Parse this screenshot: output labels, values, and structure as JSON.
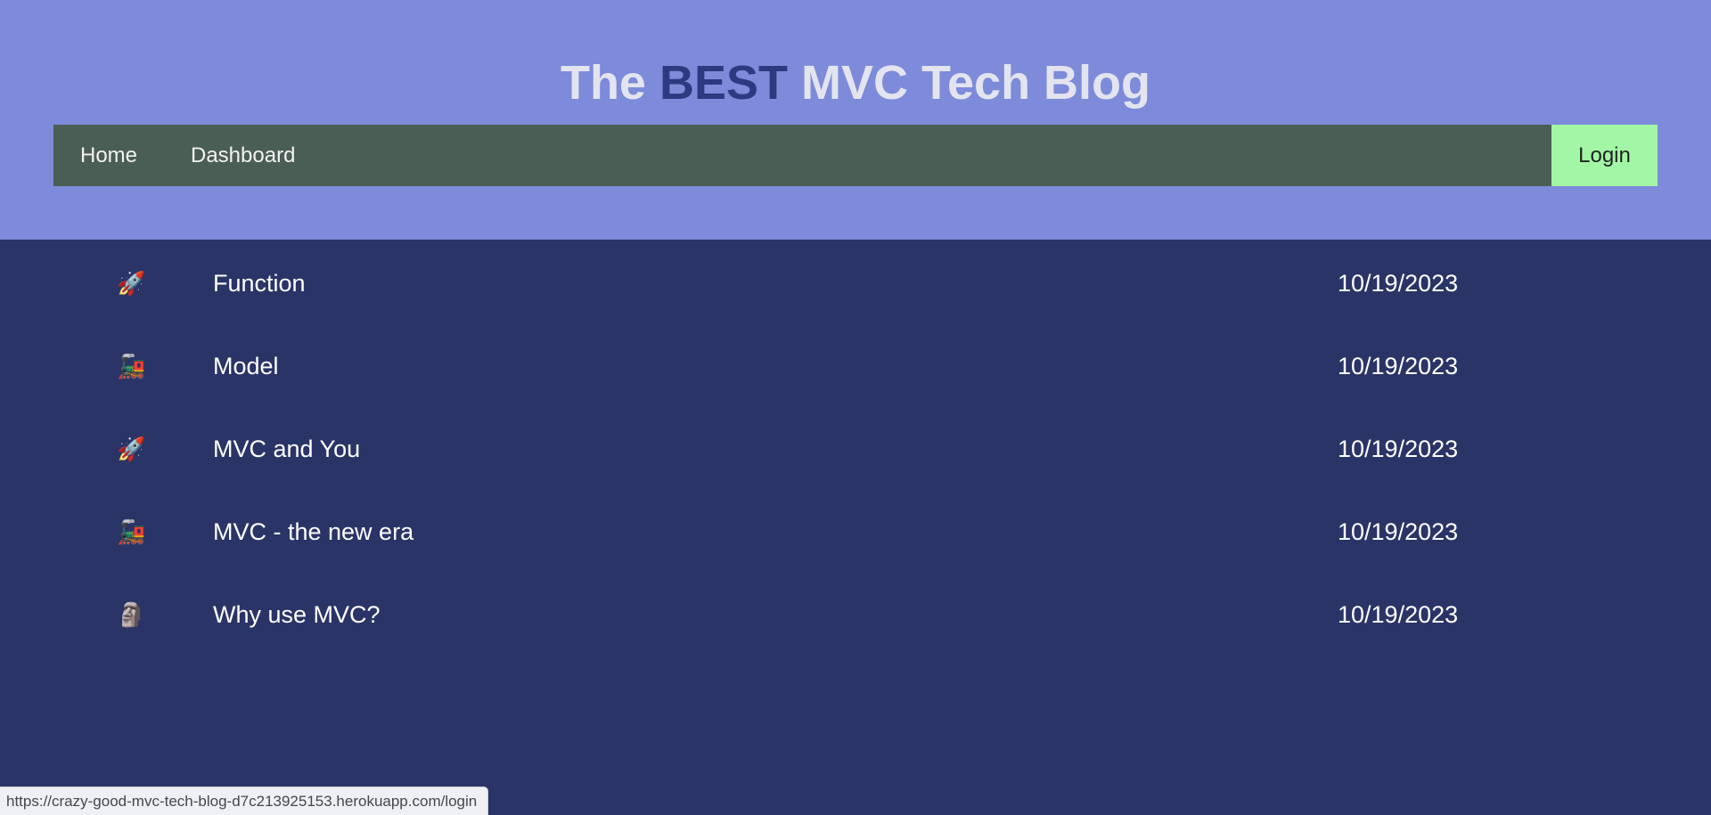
{
  "header": {
    "title_prefix": "The",
    "title_accent": "BEST",
    "title_suffix": "MVC Tech Blog"
  },
  "nav": {
    "home": "Home",
    "dashboard": "Dashboard",
    "login": "Login"
  },
  "posts": [
    {
      "icon": "rocket-icon",
      "glyph": "🚀",
      "title": "Function",
      "date": "10/19/2023"
    },
    {
      "icon": "locomotive-icon",
      "glyph": "🚂",
      "title": "Model",
      "date": "10/19/2023"
    },
    {
      "icon": "rocket-icon",
      "glyph": "🚀",
      "title": "MVC and You",
      "date": "10/19/2023"
    },
    {
      "icon": "locomotive-icon",
      "glyph": "🚂",
      "title": "MVC - the new era",
      "date": "10/19/2023"
    },
    {
      "icon": "moai-icon",
      "glyph": "🗿",
      "title": "Why use MVC?",
      "date": "10/19/2023"
    }
  ],
  "status_bar": {
    "url": "https://crazy-good-mvc-tech-blog-d7c213925153.herokuapp.com/login"
  },
  "colors": {
    "header_bg": "#7d8bda",
    "page_bg": "#2a3467",
    "navbar_bg": "#4b5e55",
    "login_bg": "#a3f6a5",
    "title_accent": "#2d3a80"
  }
}
